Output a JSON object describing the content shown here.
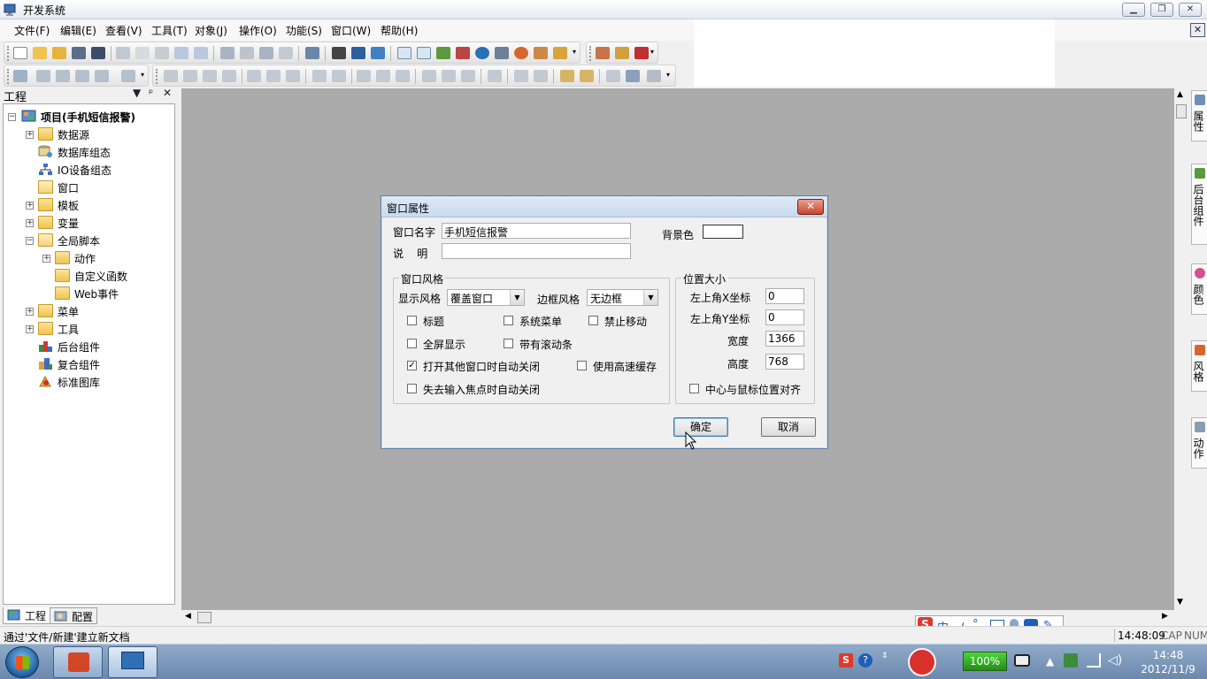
{
  "window": {
    "title": "开发系统"
  },
  "menu": [
    "文件(F)",
    "编辑(E)",
    "查看(V)",
    "工具(T)",
    "对象(J)",
    "操作(O)",
    "功能(S)",
    "窗口(W)",
    "帮助(H)"
  ],
  "project_pane": {
    "title": "工程",
    "tree": [
      {
        "label": "项目(手机短信报警)",
        "bold": true
      },
      {
        "label": "数据源"
      },
      {
        "label": "数据库组态"
      },
      {
        "label": "IO设备组态"
      },
      {
        "label": "窗口"
      },
      {
        "label": "模板"
      },
      {
        "label": "变量"
      },
      {
        "label": "全局脚本"
      },
      {
        "label": "动作"
      },
      {
        "label": "自定义函数"
      },
      {
        "label": "Web事件"
      },
      {
        "label": "菜单"
      },
      {
        "label": "工具"
      },
      {
        "label": "后台组件"
      },
      {
        "label": "复合组件"
      },
      {
        "label": "标准图库"
      }
    ],
    "tabs": [
      "工程",
      "配置"
    ]
  },
  "right_tabs": [
    "属性",
    "后台组件",
    "颜色",
    "风格",
    "动作"
  ],
  "dialog": {
    "title": "窗口属性",
    "name_label": "窗口名字",
    "name_value": "手机短信报警",
    "desc_label": "说    明",
    "desc_value": "",
    "bg_label": "背景色",
    "bg_color": "#ffffff",
    "style_group": "窗口风格",
    "display_style_label": "显示风格",
    "display_style_value": "覆盖窗口",
    "border_style_label": "边框风格",
    "border_style_value": "无边框",
    "checkboxes": {
      "title": {
        "label": "标题",
        "checked": false
      },
      "system_menu": {
        "label": "系统菜单",
        "checked": false
      },
      "no_move": {
        "label": "禁止移动",
        "checked": false
      },
      "fullscreen": {
        "label": "全屏显示",
        "checked": false
      },
      "scrollbar": {
        "label": "带有滚动条",
        "checked": false
      },
      "auto_close": {
        "label": "打开其他窗口时自动关闭",
        "checked": true
      },
      "cache": {
        "label": "使用高速缓存",
        "checked": false
      },
      "focus_close": {
        "label": "失去输入焦点时自动关闭",
        "checked": false
      },
      "center": {
        "label": "中心与鼠标位置对齐",
        "checked": false
      }
    },
    "pos_group": "位置大小",
    "left_x_label": "左上角X坐标",
    "left_x_value": "0",
    "left_y_label": "左上角Y坐标",
    "left_y_value": "0",
    "width_label": "宽度",
    "width_value": "1366",
    "height_label": "高度",
    "height_value": "768",
    "ok_label": "确定",
    "cancel_label": "取消"
  },
  "ime": {
    "items": [
      "中",
      "ノ",
      "°,"
    ]
  },
  "status": {
    "text": "通过'文件/新建'建立新文档",
    "time": "14:48:09",
    "cap": "CAP",
    "num": "NUM"
  },
  "taskbar": {
    "battery": "100%",
    "clock_time": "14:48",
    "clock_date": "2012/11/9"
  },
  "colors": {
    "workspace": "#ababab",
    "dialog_title": "#c9dbee",
    "taskbar": "#7b97ba"
  }
}
